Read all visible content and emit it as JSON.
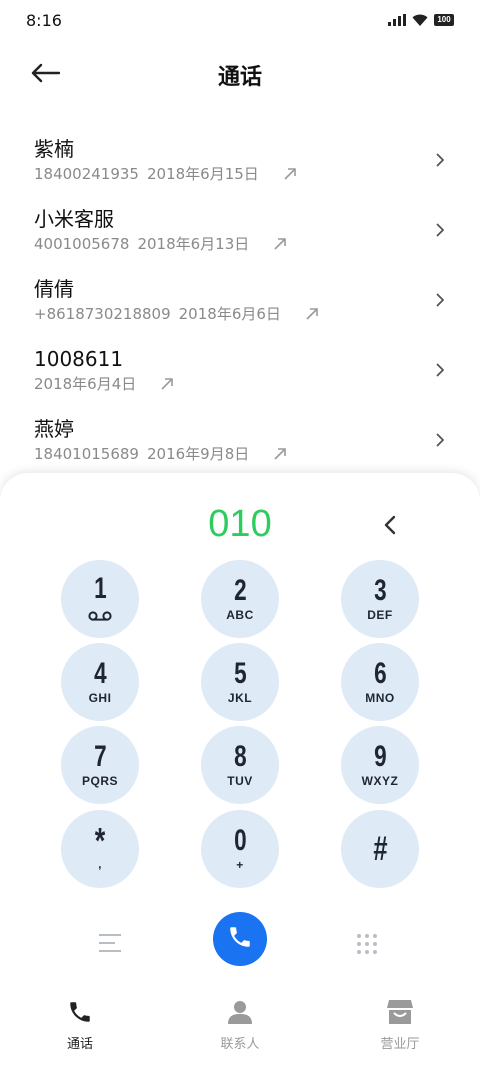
{
  "status_bar": {
    "time": "8:16",
    "battery": "100"
  },
  "header": {
    "title": "通话"
  },
  "calls": [
    {
      "name": "紫楠",
      "number": "18400241935",
      "date": "2018年6月15日"
    },
    {
      "name": "小米客服",
      "number": "4001005678",
      "date": "2018年6月13日"
    },
    {
      "name": "倩倩",
      "number": "+8618730218809",
      "date": "2018年6月6日"
    },
    {
      "name": "1008611",
      "number": "",
      "date": "2018年6月4日"
    },
    {
      "name": "燕婷",
      "number": "18401015689",
      "date": "2016年9月8日"
    }
  ],
  "dialer": {
    "entered_number": "010",
    "keys": [
      {
        "digit": "1",
        "letters": ""
      },
      {
        "digit": "2",
        "letters": "ABC"
      },
      {
        "digit": "3",
        "letters": "DEF"
      },
      {
        "digit": "4",
        "letters": "GHI"
      },
      {
        "digit": "5",
        "letters": "JKL"
      },
      {
        "digit": "6",
        "letters": "MNO"
      },
      {
        "digit": "7",
        "letters": "PQRS"
      },
      {
        "digit": "8",
        "letters": "TUV"
      },
      {
        "digit": "9",
        "letters": "WXYZ"
      },
      {
        "digit": "*",
        "letters": ","
      },
      {
        "digit": "0",
        "letters": "+"
      },
      {
        "digit": "#",
        "letters": ""
      }
    ]
  },
  "bottom_nav": {
    "items": [
      {
        "label": "通话",
        "icon": "phone-icon",
        "active": true
      },
      {
        "label": "联系人",
        "icon": "person-icon",
        "active": false
      },
      {
        "label": "营业厅",
        "icon": "store-icon",
        "active": false
      }
    ]
  },
  "colors": {
    "accent_green": "#2ecc5e",
    "call_button_blue": "#1a73f0",
    "key_background": "#dfeaf7"
  }
}
